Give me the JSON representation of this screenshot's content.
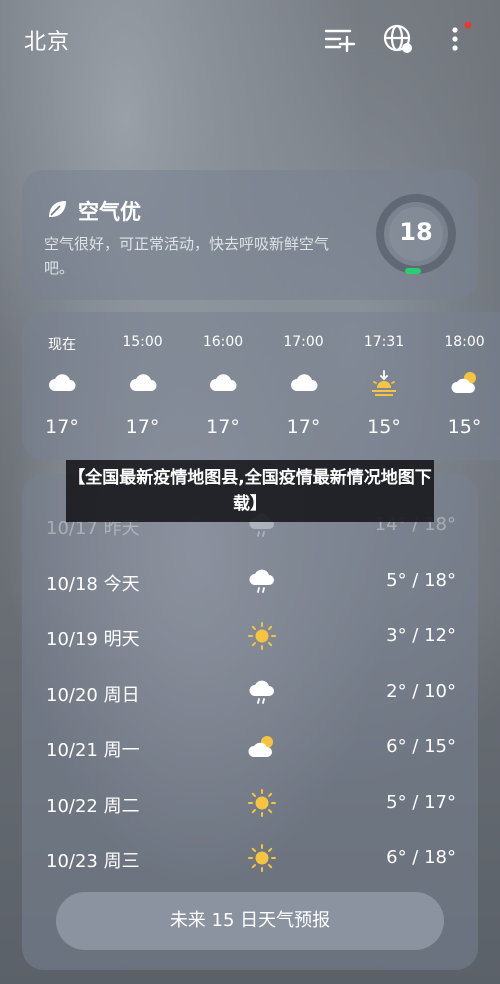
{
  "header": {
    "city": "北京",
    "icons": [
      "add-list-icon",
      "globe-icon",
      "more-icon"
    ],
    "notification_color": "#e53935"
  },
  "air_quality": {
    "title": "空气优",
    "description": "空气很好，可正常活动，快去呼吸新鲜空气吧。",
    "aqi": "18",
    "indicator_color": "#2ecc71"
  },
  "hourly": [
    {
      "time": "现在",
      "icon": "cloud-icon",
      "temp": "17°"
    },
    {
      "time": "15:00",
      "icon": "cloud-icon",
      "temp": "17°"
    },
    {
      "time": "16:00",
      "icon": "cloud-icon",
      "temp": "17°"
    },
    {
      "time": "17:00",
      "icon": "cloud-icon",
      "temp": "17°"
    },
    {
      "time": "17:31",
      "icon": "sunset-icon",
      "temp": "15°"
    },
    {
      "time": "18:00",
      "icon": "partly-cloudy-icon",
      "temp": "15°"
    }
  ],
  "daily": [
    {
      "date": "10/17 昨天",
      "icon": "rain-cloud-icon",
      "range": "14° / 18°"
    },
    {
      "date": "10/18 今天",
      "icon": "rain-cloud-icon",
      "range": "5° / 18°"
    },
    {
      "date": "10/19 明天",
      "icon": "sun-icon",
      "range": "3° / 12°"
    },
    {
      "date": "10/20 周日",
      "icon": "rain-cloud-icon",
      "range": "2° / 10°"
    },
    {
      "date": "10/21 周一",
      "icon": "partly-cloudy-icon",
      "range": "6° / 15°"
    },
    {
      "date": "10/22 周二",
      "icon": "sun-icon",
      "range": "5° / 17°"
    },
    {
      "date": "10/23 周三",
      "icon": "sun-icon",
      "range": "6° / 18°"
    }
  ],
  "forecast_button": "未来 15 日天气预报",
  "overlay_banner": "【全国最新疫情地图县,全国疫情最新情况地图下载】",
  "colors": {
    "sun": "#f5c542",
    "accent_green": "#2ecc71"
  }
}
